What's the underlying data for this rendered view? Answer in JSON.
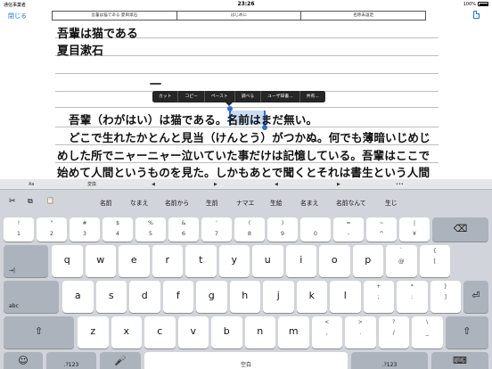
{
  "status": {
    "carrier": "通信事業者",
    "time": "23:26",
    "battery": "100%"
  },
  "nav": {
    "close": "閉じる",
    "tabs": [
      "吾輩は猫である 夏目漱石",
      "はじめに",
      "名称未設定"
    ]
  },
  "doc": {
    "title": "吾輩は猫である",
    "author": "夏目漱石",
    "chapter": "一",
    "para1_before": "吾輩（わがはい）は猫である。",
    "para1_sel": "名前",
    "para1_after": "はまだ無い。",
    "para2": "どこで生れたかとんと見当（けんとう）がつかぬ。何でも薄暗いじめじ",
    "para3": "めした所でニャーニャー泣いていた事だけは記憶している。吾輩はここで",
    "para4": "始めて人間というものを見た。しかもあとで聞くとそれは書生という人間"
  },
  "editmenu": [
    "カット",
    "コピー",
    "ペースト",
    "調べる",
    "ユーザ辞書...",
    "共有..."
  ],
  "toolbar": {
    "aa": "Aa",
    "convert": "変換",
    "left": "◀",
    "right": "▶",
    "left2": "◀",
    "right2": "▶",
    "more": "•••"
  },
  "candidates": [
    "名前",
    "なまえ",
    "名前から",
    "生前",
    "ナマエ",
    "生絵",
    "名まえ",
    "名前なんて",
    "生じ"
  ],
  "icons": {
    "cut": "✂",
    "copy": "⧉",
    "paste": "📋"
  },
  "keys": {
    "row1": [
      {
        "m": "1",
        "s": "!"
      },
      {
        "m": "2",
        "s": "\""
      },
      {
        "m": "3",
        "s": "#"
      },
      {
        "m": "4",
        "s": "$"
      },
      {
        "m": "5",
        "s": "%"
      },
      {
        "m": "6",
        "s": "&"
      },
      {
        "m": "7",
        "s": "'"
      },
      {
        "m": "8",
        "s": "("
      },
      {
        "m": "9",
        "s": ")"
      },
      {
        "m": "0",
        "s": ""
      },
      {
        "m": "-",
        "s": "="
      },
      {
        "m": "^",
        "s": "~"
      },
      {
        "m": "¥",
        "s": "|"
      }
    ],
    "row2": [
      "q",
      "w",
      "e",
      "r",
      "t",
      "y",
      "u",
      "i",
      "o",
      "p"
    ],
    "row2_extra": [
      {
        "m": "@",
        "s": "`"
      },
      {
        "m": "[",
        "s": "{"
      }
    ],
    "row3": [
      "a",
      "s",
      "d",
      "f",
      "g",
      "h",
      "j",
      "k",
      "l"
    ],
    "row3_extra": [
      {
        "m": ";",
        "s": "+"
      },
      {
        "m": ":",
        "s": "*"
      },
      {
        "m": "]",
        "s": "}"
      }
    ],
    "row4": [
      "z",
      "x",
      "c",
      "v",
      "b",
      "n",
      "m"
    ],
    "row4_extra": [
      {
        "m": ",",
        "s": "<"
      },
      {
        "m": ".",
        "s": ">"
      },
      {
        "m": "/",
        "s": "?"
      },
      {
        "m": "_",
        "s": "\\"
      }
    ],
    "tab": "→|",
    "abc": "abc",
    "shift": "⇧",
    "delete": "⌫",
    "return": "⏎",
    "emoji": "☺",
    "num": ".?123",
    "mic": "🎤",
    "space": "空白",
    "hide": "⌨"
  }
}
